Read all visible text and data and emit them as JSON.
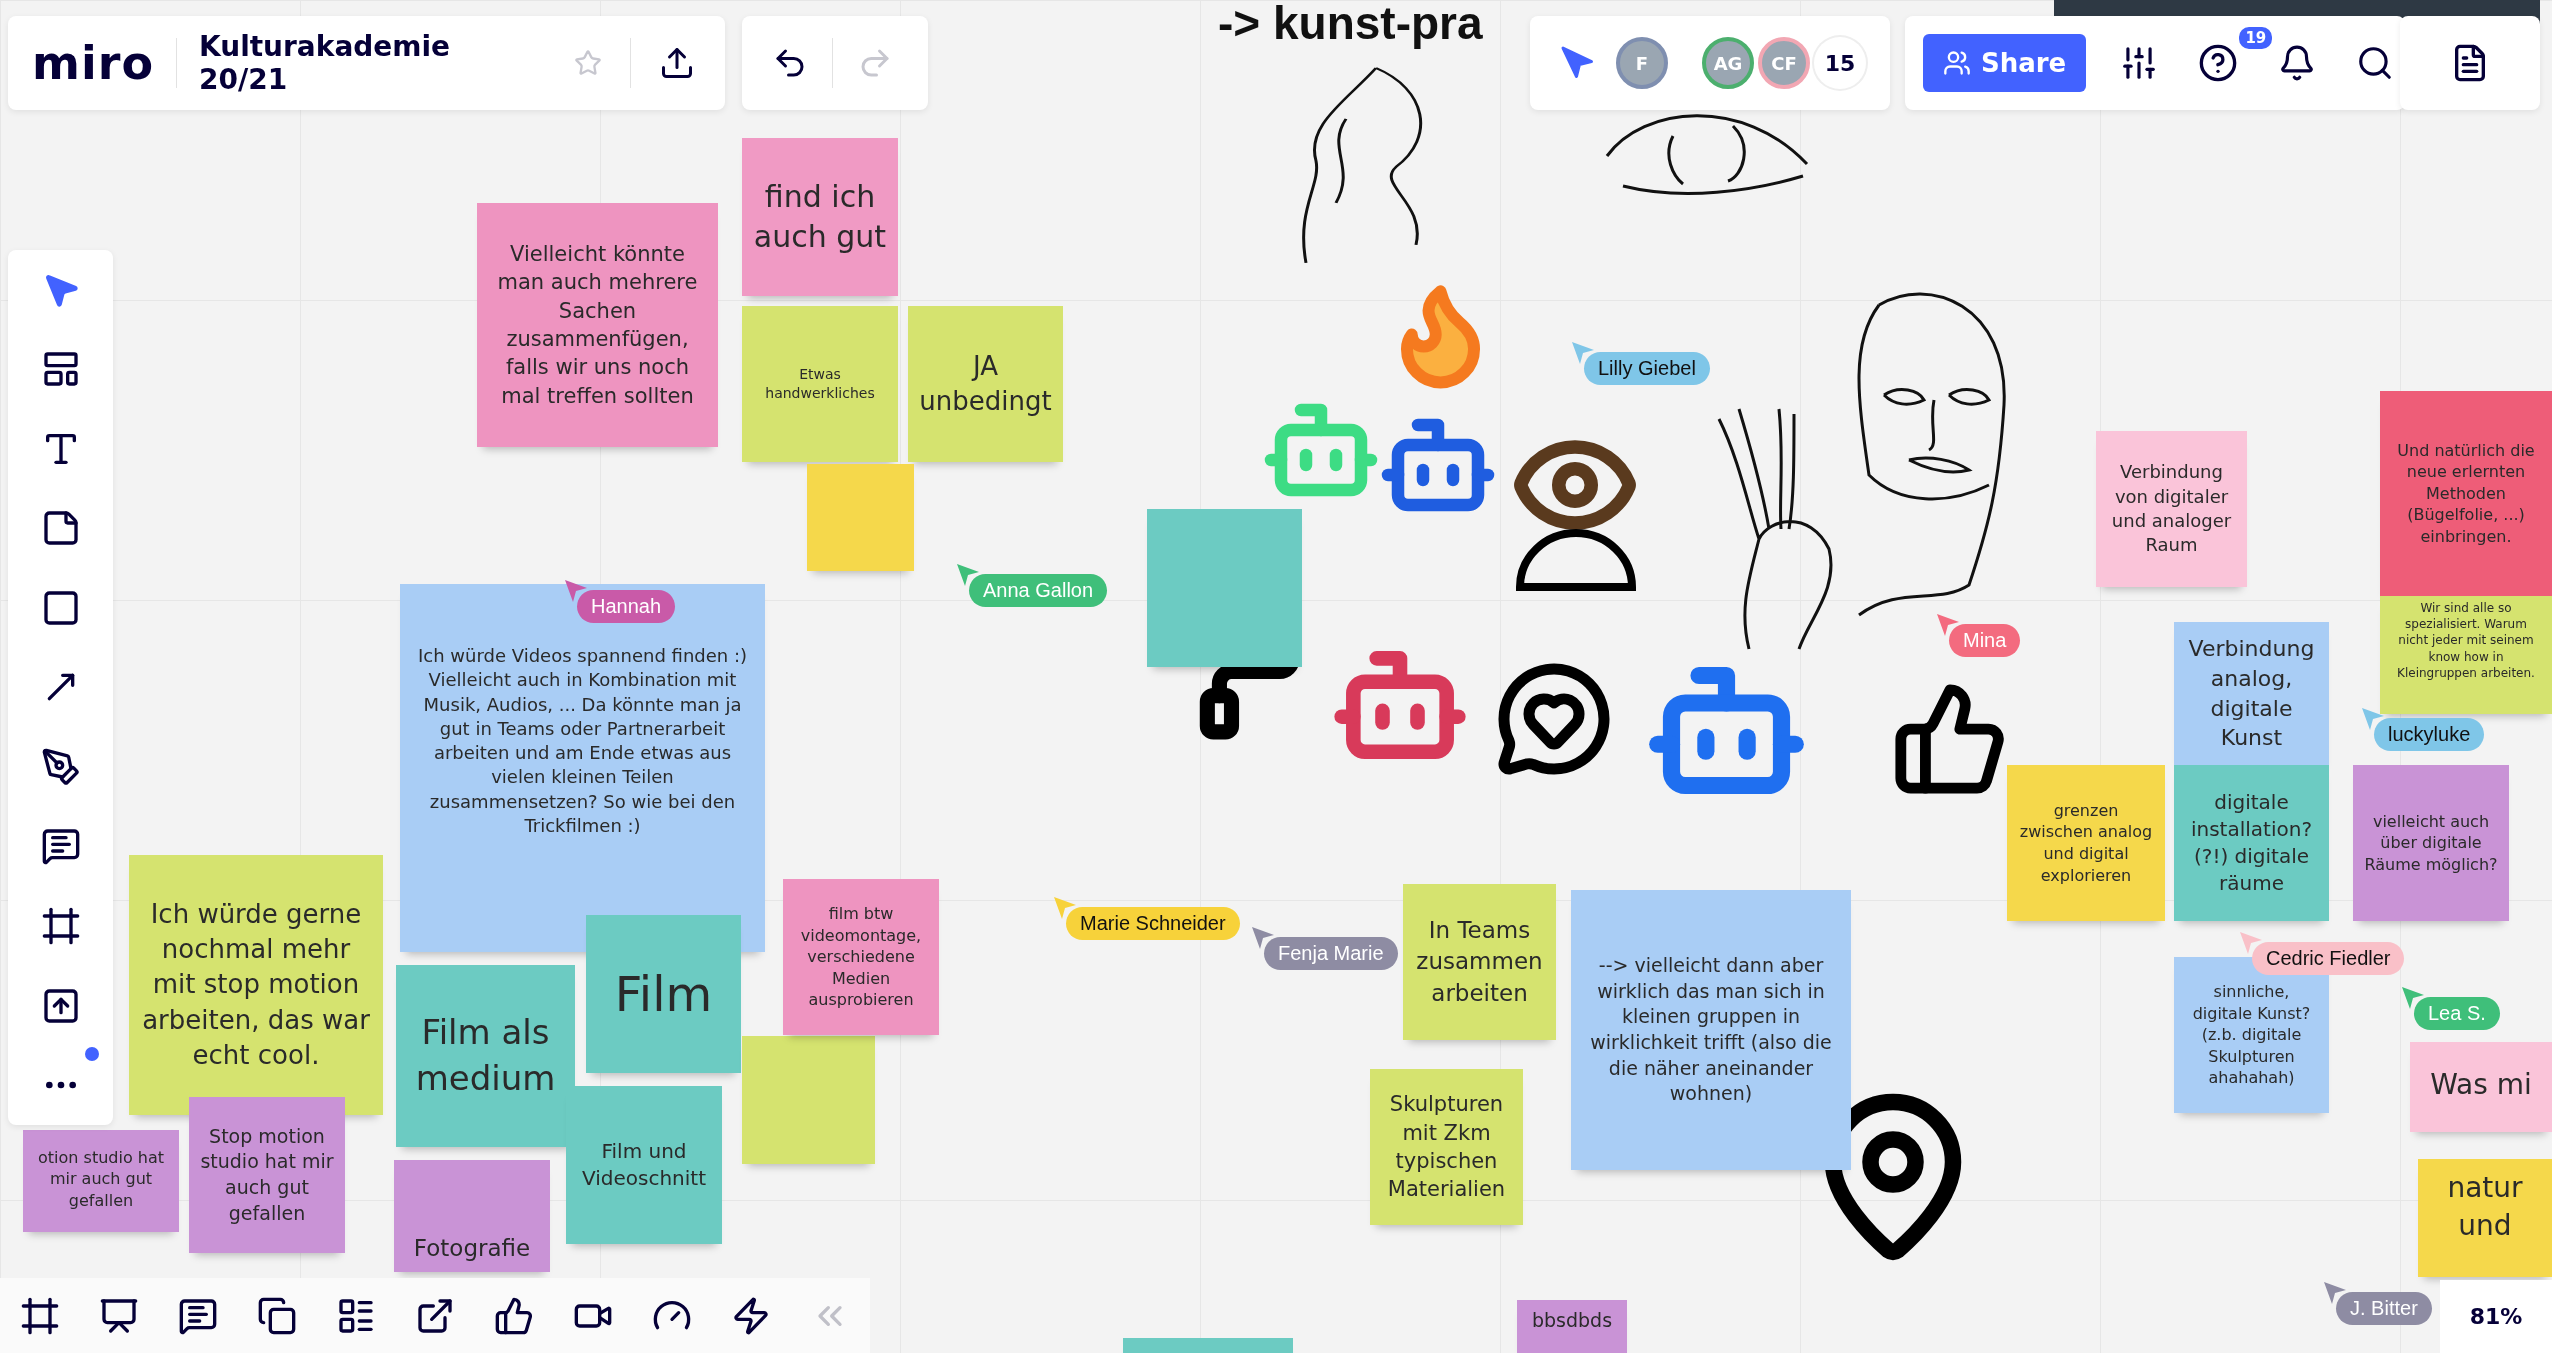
{
  "board": {
    "heading": "-> kunst-pra"
  },
  "top_bar": {
    "logo": "miro",
    "board_title": "Kulturakademie 20/21",
    "starred": false,
    "undo": {
      "disabled": false
    },
    "redo": {
      "disabled": true
    }
  },
  "collaborators": {
    "avatars": [
      {
        "initials": "F",
        "color": "#7f8fb0"
      },
      {
        "initials": "AG",
        "color": "#4caf6e"
      },
      {
        "initials": "CF",
        "color": "#f2a7b3"
      }
    ],
    "count": "15"
  },
  "actions": {
    "share": "Share",
    "help_badge": "19"
  },
  "left_toolbar": [
    {
      "kind": "select",
      "selected": true
    },
    {
      "kind": "templates",
      "selected": false
    },
    {
      "kind": "text",
      "selected": false
    },
    {
      "kind": "sticky",
      "selected": false
    },
    {
      "kind": "shape",
      "selected": false
    },
    {
      "kind": "arrow",
      "selected": false
    },
    {
      "kind": "pen",
      "selected": false
    },
    {
      "kind": "comment",
      "selected": false
    },
    {
      "kind": "frame",
      "selected": false
    },
    {
      "kind": "upload",
      "selected": false
    },
    {
      "kind": "more",
      "selected": false,
      "notification": true
    }
  ],
  "bottom_toolbar": [
    {
      "kind": "frames"
    },
    {
      "kind": "present"
    },
    {
      "kind": "comments"
    },
    {
      "kind": "cards"
    },
    {
      "kind": "kanban"
    },
    {
      "kind": "export"
    },
    {
      "kind": "voting"
    },
    {
      "kind": "video"
    },
    {
      "kind": "timer"
    },
    {
      "kind": "apps"
    },
    {
      "kind": "collapse"
    }
  ],
  "stickies": [
    {
      "text": "Vielleicht könnte man auch mehrere Sachen zusammenfügen, falls wir uns noch mal treffen sollten",
      "color": "#ee94c0"
    },
    {
      "text": "find ich auch gut",
      "color": "#f09ac4"
    },
    {
      "text": "Etwas handwerkliches",
      "color": "#d5e36f"
    },
    {
      "text": "JA unbedingt",
      "color": "#d5e36f"
    },
    {
      "color": "#f5d84b"
    },
    {
      "text": "Ich würde Videos spannend finden :) Vielleicht auch in Kombination mit Musik, Audios, ... Da könnte man ja gut in Teams oder Partnerarbeit arbeiten und am Ende etwas aus vielen kleinen Teilen zusammensetzen? So wie bei den Trickfilmen :)",
      "color": "#a9cdf5"
    },
    {
      "color": "#6ccbc2"
    },
    {
      "text": "Ich würde gerne nochmal mehr mit stop motion arbeiten, das war echt cool.",
      "color": "#d5e36f"
    },
    {
      "text": "otion studio hat mir auch gut gefallen",
      "color": "#c993d6"
    },
    {
      "text": "Stop motion studio hat mir auch gut gefallen",
      "color": "#c993d6"
    },
    {
      "text": "Film als medium",
      "color": "#6ccbc2"
    },
    {
      "text": "Film",
      "color": "#6ccbc2"
    },
    {
      "color": "#d5e36f"
    },
    {
      "text": "film  btw videomontage, verschiedene Medien ausprobieren",
      "color": "#ee94c0"
    },
    {
      "text": "Film und Videoschnitt",
      "color": "#6ccbc2"
    },
    {
      "text": "Fotografie",
      "color": "#c993d6"
    },
    {
      "text": "In Teams zusammen arbeiten",
      "color": "#d5e36f"
    },
    {
      "text": "--> vielleicht dann aber wirklich das man sich in kleinen gruppen in wirklichkeit trifft (also die die näher aneinander wohnen)",
      "color": "#a9cdf5"
    },
    {
      "text": "Skulpturen mit Zkm typischen Materialien",
      "color": "#d5e36f"
    },
    {
      "text": "bbsdbds",
      "color": "#c993d6"
    },
    {
      "color": "#6ccbc2"
    },
    {
      "text": "Verbindung von digitaler und analoger Raum",
      "color": "#fac4d9"
    },
    {
      "text": "Und natürlich die neue erlernten Methoden (Bügelfolie, ...) einbringen.",
      "color": "#ee5d78"
    },
    {
      "text": "Wir sind alle so spezialisiert. Warum nicht jeder mit seinem know how in Kleingruppen arbeiten.",
      "color": "#d5e36f"
    },
    {
      "text": "Verbindung analog, digitale Kunst",
      "color": "#a9cdf5"
    },
    {
      "text": "grenzen zwischen analog und digital explorieren",
      "color": "#f5d84b"
    },
    {
      "text": "digitale installation? (?!) digitale räume",
      "color": "#6ccbc2"
    },
    {
      "text": "vielleicht auch über digitale Räume möglich?",
      "color": "#c993d6"
    },
    {
      "text": "sinnliche, digitale Kunst? (z.b.  digitale Skulpturen ahahahah)",
      "color": "#a9cdf5"
    },
    {
      "text": "Was mi",
      "color": "#fac4d9"
    },
    {
      "text": "natur und",
      "color": "#f5d84b"
    }
  ],
  "cursors": [
    {
      "name": "Hannah",
      "color": "#c95aa8"
    },
    {
      "name": "Anna Gallon",
      "color": "#3fbf7a"
    },
    {
      "name": "Lilly Giebel",
      "color": "#7fc6e8"
    },
    {
      "name": "Mina",
      "color": "#f36b7f"
    },
    {
      "name": "luckyluke",
      "color": "#7fc6e8"
    },
    {
      "name": "Marie Schneider",
      "color": "#f7d23a"
    },
    {
      "name": "Fenja Marie",
      "color": "#8e8ca3"
    },
    {
      "name": "Cedric Fiedler",
      "color": "#f9c0c8"
    },
    {
      "name": "Lea S.",
      "color": "#3fbf7a"
    },
    {
      "name": "J. Bitter",
      "color": "#8e8ca3"
    }
  ],
  "zoom": "81%"
}
